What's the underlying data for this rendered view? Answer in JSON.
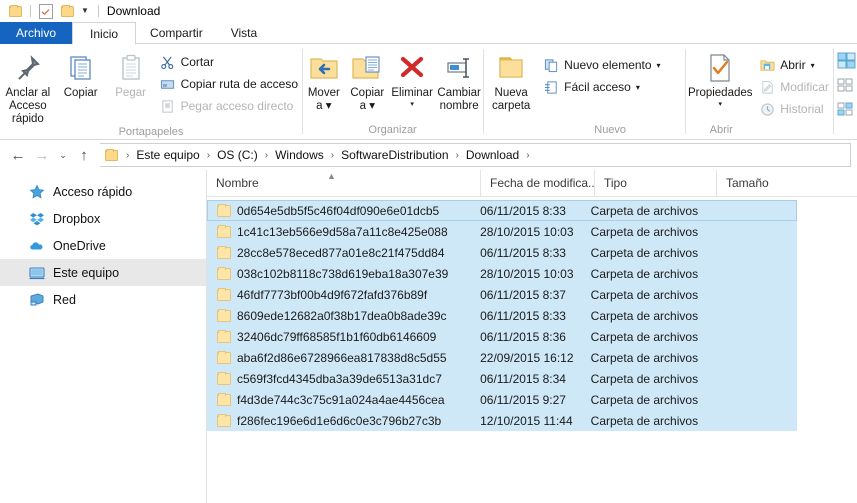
{
  "window": {
    "title": "Download",
    "quick_access": [
      "folder-icon",
      "properties-icon",
      "new-folder-icon",
      "customize-dropdown"
    ]
  },
  "tabs": [
    {
      "label": "Archivo",
      "style": "file"
    },
    {
      "label": "Inicio",
      "style": "active"
    },
    {
      "label": "Compartir",
      "style": "normal"
    },
    {
      "label": "Vista",
      "style": "normal"
    }
  ],
  "ribbon": {
    "groups": [
      {
        "name": "Portapapeles",
        "big": [
          {
            "label_line1": "Anclar al",
            "label_line2": "Acceso rápido",
            "icon": "pin-icon",
            "disabled": false
          },
          {
            "label_line1": "Copiar",
            "label_line2": "",
            "icon": "copy-icon",
            "disabled": false
          },
          {
            "label_line1": "Pegar",
            "label_line2": "",
            "icon": "paste-icon",
            "disabled": true
          }
        ],
        "small": [
          {
            "label": "Cortar",
            "icon": "scissors-icon",
            "disabled": false
          },
          {
            "label": "Copiar ruta de acceso",
            "icon": "copy-path-icon",
            "disabled": false
          },
          {
            "label": "Pegar acceso directo",
            "icon": "paste-shortcut-icon",
            "disabled": true
          }
        ]
      },
      {
        "name": "Organizar",
        "big": [
          {
            "label_line1": "Mover",
            "label_line2": "a",
            "icon": "move-to-icon",
            "caret": true,
            "disabled": false
          },
          {
            "label_line1": "Copiar",
            "label_line2": "a",
            "icon": "copy-to-icon",
            "caret": true,
            "disabled": false
          },
          {
            "label_line1": "Eliminar",
            "label_line2": "",
            "icon": "delete-icon",
            "caret": true,
            "disabled": false
          },
          {
            "label_line1": "Cambiar",
            "label_line2": "nombre",
            "icon": "rename-icon",
            "caret": false,
            "disabled": false
          }
        ],
        "small": []
      },
      {
        "name": "Nuevo",
        "big": [
          {
            "label_line1": "Nueva",
            "label_line2": "carpeta",
            "icon": "new-folder-icon",
            "disabled": false
          }
        ],
        "small": [
          {
            "label": "Nuevo elemento",
            "icon": "new-item-icon",
            "caret": true,
            "disabled": false
          },
          {
            "label": "Fácil acceso",
            "icon": "easy-access-icon",
            "caret": true,
            "disabled": false
          }
        ]
      },
      {
        "name": "Abrir",
        "big": [
          {
            "label_line1": "Propiedades",
            "label_line2": "",
            "icon": "properties-icon",
            "caret": true,
            "disabled": false
          }
        ],
        "small": [
          {
            "label": "Abrir",
            "icon": "open-icon",
            "caret": true,
            "disabled": false
          },
          {
            "label": "Modificar",
            "icon": "edit-icon",
            "disabled": true
          },
          {
            "label": "Historial",
            "icon": "history-icon",
            "disabled": true
          }
        ]
      }
    ]
  },
  "address": {
    "back": "←",
    "forward": "→",
    "recent": "⌄",
    "up": "↑",
    "breadcrumbs": [
      "Este equipo",
      "OS (C:)",
      "Windows",
      "SoftwareDistribution",
      "Download"
    ],
    "trailing_separator": "›"
  },
  "sidebar": {
    "items": [
      {
        "label": "Acceso rápido",
        "icon": "star-icon",
        "selected": false
      },
      {
        "label": "Dropbox",
        "icon": "dropbox-icon",
        "selected": false
      },
      {
        "label": "OneDrive",
        "icon": "cloud-icon",
        "selected": false
      },
      {
        "label": "Este equipo",
        "icon": "computer-icon",
        "selected": true
      },
      {
        "label": "Red",
        "icon": "network-icon",
        "selected": false
      }
    ]
  },
  "file_list": {
    "columns": [
      {
        "label": "Nombre",
        "key": "name",
        "sorted": "asc"
      },
      {
        "label": "Fecha de modifica...",
        "key": "date"
      },
      {
        "label": "Tipo",
        "key": "type"
      },
      {
        "label": "Tamaño",
        "key": "size"
      }
    ],
    "rows": [
      {
        "name": "0d654e5db5f5c46f04df090e6e01dcb5",
        "date": "06/11/2015 8:33",
        "type": "Carpeta de archivos",
        "size": "",
        "selected": true,
        "focused": true
      },
      {
        "name": "1c41c13eb566e9d58a7a11c8e425e088",
        "date": "28/10/2015 10:03",
        "type": "Carpeta de archivos",
        "size": "",
        "selected": true,
        "focused": false
      },
      {
        "name": "28cc8e578eced877a01e8c21f475dd84",
        "date": "06/11/2015 8:33",
        "type": "Carpeta de archivos",
        "size": "",
        "selected": true,
        "focused": false
      },
      {
        "name": "038c102b8118c738d619eba18a307e39",
        "date": "28/10/2015 10:03",
        "type": "Carpeta de archivos",
        "size": "",
        "selected": true,
        "focused": false
      },
      {
        "name": "46fdf7773bf00b4d9f672fafd376b89f",
        "date": "06/11/2015 8:37",
        "type": "Carpeta de archivos",
        "size": "",
        "selected": true,
        "focused": false
      },
      {
        "name": "8609ede12682a0f38b17dea0b8ade39c",
        "date": "06/11/2015 8:33",
        "type": "Carpeta de archivos",
        "size": "",
        "selected": true,
        "focused": false
      },
      {
        "name": "32406dc79ff68585f1b1f60db6146609",
        "date": "06/11/2015 8:36",
        "type": "Carpeta de archivos",
        "size": "",
        "selected": true,
        "focused": false
      },
      {
        "name": "aba6f2d86e6728966ea817838d8c5d55",
        "date": "22/09/2015 16:12",
        "type": "Carpeta de archivos",
        "size": "",
        "selected": true,
        "focused": false
      },
      {
        "name": "c569f3fcd4345dba3a39de6513a31dc7",
        "date": "06/11/2015 8:34",
        "type": "Carpeta de archivos",
        "size": "",
        "selected": true,
        "focused": false
      },
      {
        "name": "f4d3de744c3c75c91a024a4ae4456cea",
        "date": "06/11/2015 9:27",
        "type": "Carpeta de archivos",
        "size": "",
        "selected": true,
        "focused": false
      },
      {
        "name": "f286fec196e6d1e6d6c0e3c796b27c3b",
        "date": "12/10/2015 11:44",
        "type": "Carpeta de archivos",
        "size": "",
        "selected": true,
        "focused": false
      }
    ]
  },
  "colors": {
    "file_tab_blue": "#1565c0",
    "selection_blue": "#cfe8f7",
    "folder_yellow": "#fcdf9a",
    "sidebar_selected": "#e8e8e8"
  }
}
